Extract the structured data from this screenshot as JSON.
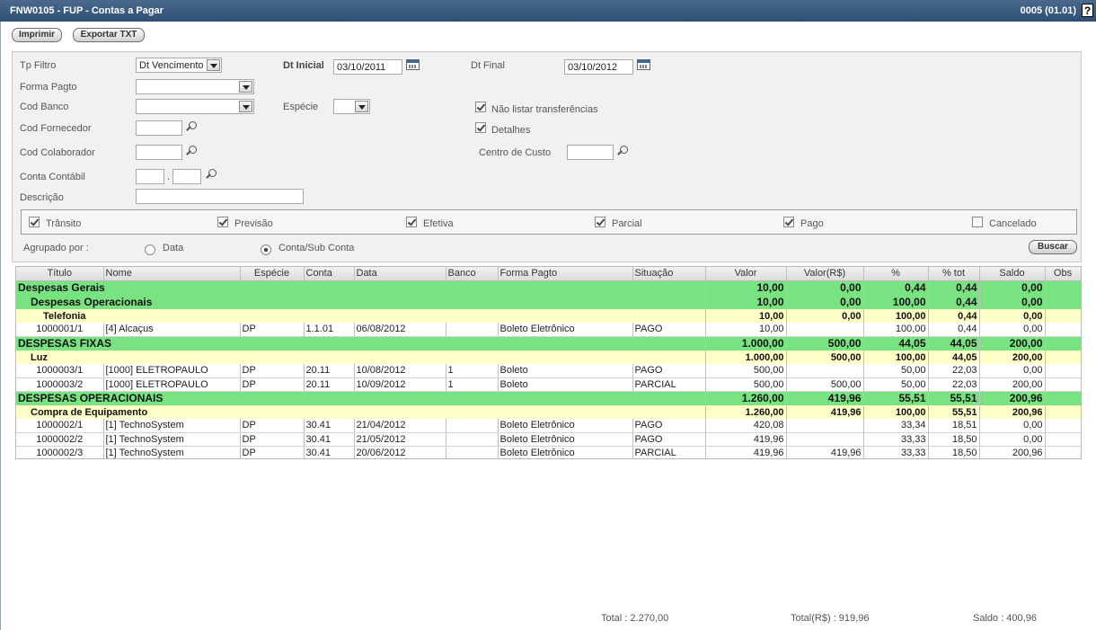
{
  "window": {
    "title": "FNW0105 - FUP - Contas a Pagar",
    "version": "0005 (01.01)",
    "help": "?"
  },
  "toolbar": {
    "print_label": "Imprimir",
    "export_label": "Exportar TXT"
  },
  "filters": {
    "tp_filtro": {
      "label": "Tp Filtro",
      "value": "Dt Vencimento"
    },
    "dt_inicial": {
      "label": "Dt Inicial",
      "value": "03/10/2011"
    },
    "dt_final": {
      "label": "Dt Final",
      "value": "03/10/2012"
    },
    "forma_pagto": {
      "label": "Forma Pagto",
      "value": ""
    },
    "cod_banco": {
      "label": "Cod Banco",
      "value": ""
    },
    "especie": {
      "label": "Espécie",
      "value": ""
    },
    "nao_listar": {
      "label": "Não listar transferências",
      "checked": true
    },
    "cod_fornecedor": {
      "label": "Cod Fornecedor",
      "value": ""
    },
    "detalhes": {
      "label": "Detalhes",
      "checked": true
    },
    "cod_colaborador": {
      "label": "Cod Colaborador",
      "value": ""
    },
    "centro_custo": {
      "label": "Centro de Custo",
      "value": ""
    },
    "conta_contabil": {
      "label": "Conta Contábil",
      "value1": "",
      "sep": ".",
      "value2": ""
    },
    "descricao": {
      "label": "Descrição",
      "value": ""
    }
  },
  "status_checks": [
    {
      "label": "Trânsito",
      "checked": true
    },
    {
      "label": "Previsão",
      "checked": true
    },
    {
      "label": "Efetiva",
      "checked": true
    },
    {
      "label": "Parcial",
      "checked": true
    },
    {
      "label": "Pago",
      "checked": true
    },
    {
      "label": "Cancelado",
      "checked": false
    }
  ],
  "grouping": {
    "label": "Agrupado por :",
    "options": [
      {
        "label": "Data",
        "selected": false
      },
      {
        "label": "Conta/Sub Conta",
        "selected": true
      }
    ]
  },
  "search_label": "Buscar",
  "grid": {
    "columns": [
      "Título",
      "Nome",
      "Espécie",
      "Conta",
      "Data",
      "Banco",
      "Forma Pagto",
      "Situação",
      "Valor",
      "Valor(R$)",
      "%",
      "% tot",
      "Saldo",
      "Obs"
    ],
    "rows": [
      {
        "type": "g1",
        "name": "Despesas Gerais",
        "valor": "10,00",
        "valor_rs": "0,00",
        "pct": "0,44",
        "pct_tot": "0,44",
        "saldo": "0,00"
      },
      {
        "type": "g2",
        "name": "Despesas Operacionais",
        "valor": "10,00",
        "valor_rs": "0,00",
        "pct": "100,00",
        "pct_tot": "0,44",
        "saldo": "0,00"
      },
      {
        "type": "g3deep",
        "name": "Telefonia",
        "valor": "10,00",
        "valor_rs": "0,00",
        "pct": "100,00",
        "pct_tot": "0,44",
        "saldo": "0,00"
      },
      {
        "type": "d",
        "titulo": "1000001/1",
        "nome": "[4] Alcaçus",
        "especie": "DP",
        "conta": "1.1.01",
        "data": "06/08/2012",
        "banco": "",
        "forma": "Boleto Eletrônico",
        "situacao": "PAGO",
        "valor": "10,00",
        "valor_rs": "",
        "pct": "100,00",
        "pct_tot": "0,44",
        "saldo": "0,00"
      },
      {
        "type": "g1",
        "name": "DESPESAS FIXAS",
        "valor": "1.000,00",
        "valor_rs": "500,00",
        "pct": "44,05",
        "pct_tot": "44,05",
        "saldo": "200,00"
      },
      {
        "type": "g3",
        "name": "Luz",
        "valor": "1.000,00",
        "valor_rs": "500,00",
        "pct": "100,00",
        "pct_tot": "44,05",
        "saldo": "200,00"
      },
      {
        "type": "d",
        "titulo": "1000003/1",
        "nome": "[1000] ELETROPAULO",
        "especie": "DP",
        "conta": "20.11",
        "data": "10/08/2012",
        "banco": "1",
        "forma": "Boleto",
        "situacao": "PAGO",
        "valor": "500,00",
        "valor_rs": "",
        "pct": "50,00",
        "pct_tot": "22,03",
        "saldo": "0,00"
      },
      {
        "type": "d",
        "titulo": "1000003/2",
        "nome": "[1000] ELETROPAULO",
        "especie": "DP",
        "conta": "20.11",
        "data": "10/09/2012",
        "banco": "1",
        "forma": "Boleto",
        "situacao": "PARCIAL",
        "valor": "500,00",
        "valor_rs": "500,00",
        "pct": "50,00",
        "pct_tot": "22,03",
        "saldo": "200,00"
      },
      {
        "type": "g1",
        "name": "DESPESAS OPERACIONAIS",
        "valor": "1.260,00",
        "valor_rs": "419,96",
        "pct": "55,51",
        "pct_tot": "55,51",
        "saldo": "200,96"
      },
      {
        "type": "g3",
        "name": "Compra de Equipamento",
        "valor": "1.260,00",
        "valor_rs": "419,96",
        "pct": "100,00",
        "pct_tot": "55,51",
        "saldo": "200,96"
      },
      {
        "type": "d",
        "titulo": "1000002/1",
        "nome": "[1] TechnoSystem",
        "especie": "DP",
        "conta": "30.41",
        "data": "21/04/2012",
        "banco": "",
        "forma": "Boleto Eletrônico",
        "situacao": "PAGO",
        "valor": "420,08",
        "valor_rs": "",
        "pct": "33,34",
        "pct_tot": "18,51",
        "saldo": "0,00"
      },
      {
        "type": "d",
        "titulo": "1000002/2",
        "nome": "[1] TechnoSystem",
        "especie": "DP",
        "conta": "30.41",
        "data": "21/05/2012",
        "banco": "",
        "forma": "Boleto Eletrônico",
        "situacao": "PAGO",
        "valor": "419,96",
        "valor_rs": "",
        "pct": "33,33",
        "pct_tot": "18,50",
        "saldo": "0,00"
      },
      {
        "type": "d",
        "titulo": "1000002/3",
        "nome": "[1] TechnoSystem",
        "especie": "DP",
        "conta": "30.41",
        "data": "20/06/2012",
        "banco": "",
        "forma": "Boleto Eletrônico",
        "situacao": "PARCIAL",
        "valor": "419,96",
        "valor_rs": "419,96",
        "pct": "33,33",
        "pct_tot": "18,50",
        "saldo": "200,96"
      }
    ]
  },
  "totals": {
    "total": "Total : 2.270,00",
    "total_rs": "Total(R$) : 919,96",
    "saldo": "Saldo : 400,96"
  }
}
